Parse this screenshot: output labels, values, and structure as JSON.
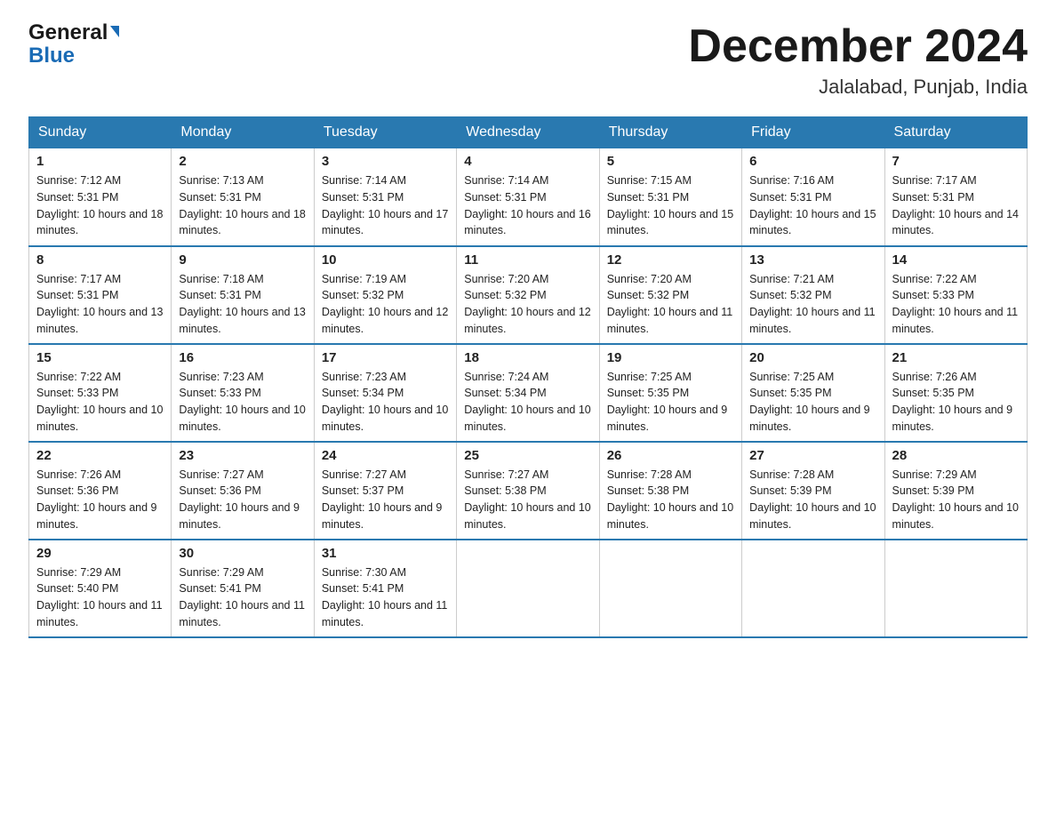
{
  "header": {
    "logo_general": "General",
    "logo_blue": "Blue",
    "month_title": "December 2024",
    "location": "Jalalabad, Punjab, India"
  },
  "days_of_week": [
    "Sunday",
    "Monday",
    "Tuesday",
    "Wednesday",
    "Thursday",
    "Friday",
    "Saturday"
  ],
  "weeks": [
    [
      {
        "date": "1",
        "sunrise": "7:12 AM",
        "sunset": "5:31 PM",
        "daylight": "10 hours and 18 minutes."
      },
      {
        "date": "2",
        "sunrise": "7:13 AM",
        "sunset": "5:31 PM",
        "daylight": "10 hours and 18 minutes."
      },
      {
        "date": "3",
        "sunrise": "7:14 AM",
        "sunset": "5:31 PM",
        "daylight": "10 hours and 17 minutes."
      },
      {
        "date": "4",
        "sunrise": "7:14 AM",
        "sunset": "5:31 PM",
        "daylight": "10 hours and 16 minutes."
      },
      {
        "date": "5",
        "sunrise": "7:15 AM",
        "sunset": "5:31 PM",
        "daylight": "10 hours and 15 minutes."
      },
      {
        "date": "6",
        "sunrise": "7:16 AM",
        "sunset": "5:31 PM",
        "daylight": "10 hours and 15 minutes."
      },
      {
        "date": "7",
        "sunrise": "7:17 AM",
        "sunset": "5:31 PM",
        "daylight": "10 hours and 14 minutes."
      }
    ],
    [
      {
        "date": "8",
        "sunrise": "7:17 AM",
        "sunset": "5:31 PM",
        "daylight": "10 hours and 13 minutes."
      },
      {
        "date": "9",
        "sunrise": "7:18 AM",
        "sunset": "5:31 PM",
        "daylight": "10 hours and 13 minutes."
      },
      {
        "date": "10",
        "sunrise": "7:19 AM",
        "sunset": "5:32 PM",
        "daylight": "10 hours and 12 minutes."
      },
      {
        "date": "11",
        "sunrise": "7:20 AM",
        "sunset": "5:32 PM",
        "daylight": "10 hours and 12 minutes."
      },
      {
        "date": "12",
        "sunrise": "7:20 AM",
        "sunset": "5:32 PM",
        "daylight": "10 hours and 11 minutes."
      },
      {
        "date": "13",
        "sunrise": "7:21 AM",
        "sunset": "5:32 PM",
        "daylight": "10 hours and 11 minutes."
      },
      {
        "date": "14",
        "sunrise": "7:22 AM",
        "sunset": "5:33 PM",
        "daylight": "10 hours and 11 minutes."
      }
    ],
    [
      {
        "date": "15",
        "sunrise": "7:22 AM",
        "sunset": "5:33 PM",
        "daylight": "10 hours and 10 minutes."
      },
      {
        "date": "16",
        "sunrise": "7:23 AM",
        "sunset": "5:33 PM",
        "daylight": "10 hours and 10 minutes."
      },
      {
        "date": "17",
        "sunrise": "7:23 AM",
        "sunset": "5:34 PM",
        "daylight": "10 hours and 10 minutes."
      },
      {
        "date": "18",
        "sunrise": "7:24 AM",
        "sunset": "5:34 PM",
        "daylight": "10 hours and 10 minutes."
      },
      {
        "date": "19",
        "sunrise": "7:25 AM",
        "sunset": "5:35 PM",
        "daylight": "10 hours and 9 minutes."
      },
      {
        "date": "20",
        "sunrise": "7:25 AM",
        "sunset": "5:35 PM",
        "daylight": "10 hours and 9 minutes."
      },
      {
        "date": "21",
        "sunrise": "7:26 AM",
        "sunset": "5:35 PM",
        "daylight": "10 hours and 9 minutes."
      }
    ],
    [
      {
        "date": "22",
        "sunrise": "7:26 AM",
        "sunset": "5:36 PM",
        "daylight": "10 hours and 9 minutes."
      },
      {
        "date": "23",
        "sunrise": "7:27 AM",
        "sunset": "5:36 PM",
        "daylight": "10 hours and 9 minutes."
      },
      {
        "date": "24",
        "sunrise": "7:27 AM",
        "sunset": "5:37 PM",
        "daylight": "10 hours and 9 minutes."
      },
      {
        "date": "25",
        "sunrise": "7:27 AM",
        "sunset": "5:38 PM",
        "daylight": "10 hours and 10 minutes."
      },
      {
        "date": "26",
        "sunrise": "7:28 AM",
        "sunset": "5:38 PM",
        "daylight": "10 hours and 10 minutes."
      },
      {
        "date": "27",
        "sunrise": "7:28 AM",
        "sunset": "5:39 PM",
        "daylight": "10 hours and 10 minutes."
      },
      {
        "date": "28",
        "sunrise": "7:29 AM",
        "sunset": "5:39 PM",
        "daylight": "10 hours and 10 minutes."
      }
    ],
    [
      {
        "date": "29",
        "sunrise": "7:29 AM",
        "sunset": "5:40 PM",
        "daylight": "10 hours and 11 minutes."
      },
      {
        "date": "30",
        "sunrise": "7:29 AM",
        "sunset": "5:41 PM",
        "daylight": "10 hours and 11 minutes."
      },
      {
        "date": "31",
        "sunrise": "7:30 AM",
        "sunset": "5:41 PM",
        "daylight": "10 hours and 11 minutes."
      },
      null,
      null,
      null,
      null
    ]
  ],
  "labels": {
    "sunrise_prefix": "Sunrise: ",
    "sunset_prefix": "Sunset: ",
    "daylight_prefix": "Daylight: "
  }
}
